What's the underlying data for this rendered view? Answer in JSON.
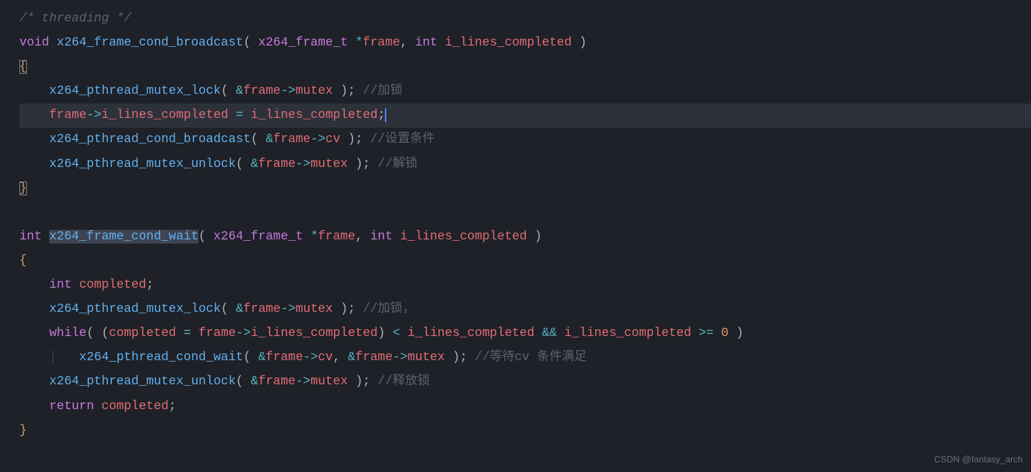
{
  "watermark": "CSDN @fantasy_arch",
  "tokens": {
    "l1_comment": "/* threading */",
    "l2_void": "void",
    "l2_func": "x264_frame_cond_broadcast",
    "l2_type": "x264_frame_t",
    "l2_star": "*",
    "l2_p1": "frame",
    "l2_int": "int",
    "l2_p2": "i_lines_completed",
    "l3_brace": "{",
    "l4_func": "x264_pthread_mutex_lock",
    "l4_amp": "&",
    "l4_var": "frame",
    "l4_arrow": "->",
    "l4_mem": "mutex",
    "l4_cmt": "//加锁",
    "l5_var": "frame",
    "l5_arrow": "->",
    "l5_mem": "i_lines_completed",
    "l5_eq": "=",
    "l5_rhs": "i_lines_completed",
    "l6_func": "x264_pthread_cond_broadcast",
    "l6_amp": "&",
    "l6_var": "frame",
    "l6_arrow": "->",
    "l6_mem": "cv",
    "l6_cmt": "//设置条件",
    "l7_func": "x264_pthread_mutex_unlock",
    "l7_amp": "&",
    "l7_var": "frame",
    "l7_arrow": "->",
    "l7_mem": "mutex",
    "l7_cmt": "//解锁",
    "l8_brace": "}",
    "l10_int": "int",
    "l10_func": "x264_frame_cond_wait",
    "l10_type": "x264_frame_t",
    "l10_star": "*",
    "l10_p1": "frame",
    "l10_int2": "int",
    "l10_p2": "i_lines_completed",
    "l11_brace": "{",
    "l12_int": "int",
    "l12_var": "completed",
    "l13_func": "x264_pthread_mutex_lock",
    "l13_amp": "&",
    "l13_var": "frame",
    "l13_arrow": "->",
    "l13_mem": "mutex",
    "l13_cmt": "//加锁，",
    "l14_while": "while",
    "l14_lhs": "completed",
    "l14_eq": "=",
    "l14_fvar": "frame",
    "l14_arrow": "->",
    "l14_mem": "i_lines_completed",
    "l14_lt": "<",
    "l14_r1": "i_lines_completed",
    "l14_and": "&&",
    "l14_r2": "i_lines_completed",
    "l14_ge": ">=",
    "l14_zero": "0",
    "l15_func": "x264_pthread_cond_wait",
    "l15_amp1": "&",
    "l15_v1": "frame",
    "l15_ar1": "->",
    "l15_m1": "cv",
    "l15_amp2": "&",
    "l15_v2": "frame",
    "l15_ar2": "->",
    "l15_m2": "mutex",
    "l15_cmt": "//等待cv 条件满足",
    "l16_func": "x264_pthread_mutex_unlock",
    "l16_amp": "&",
    "l16_var": "frame",
    "l16_arrow": "->",
    "l16_mem": "mutex",
    "l16_cmt": "//释放锁",
    "l17_return": "return",
    "l17_var": "completed",
    "l18_brace": "}"
  }
}
